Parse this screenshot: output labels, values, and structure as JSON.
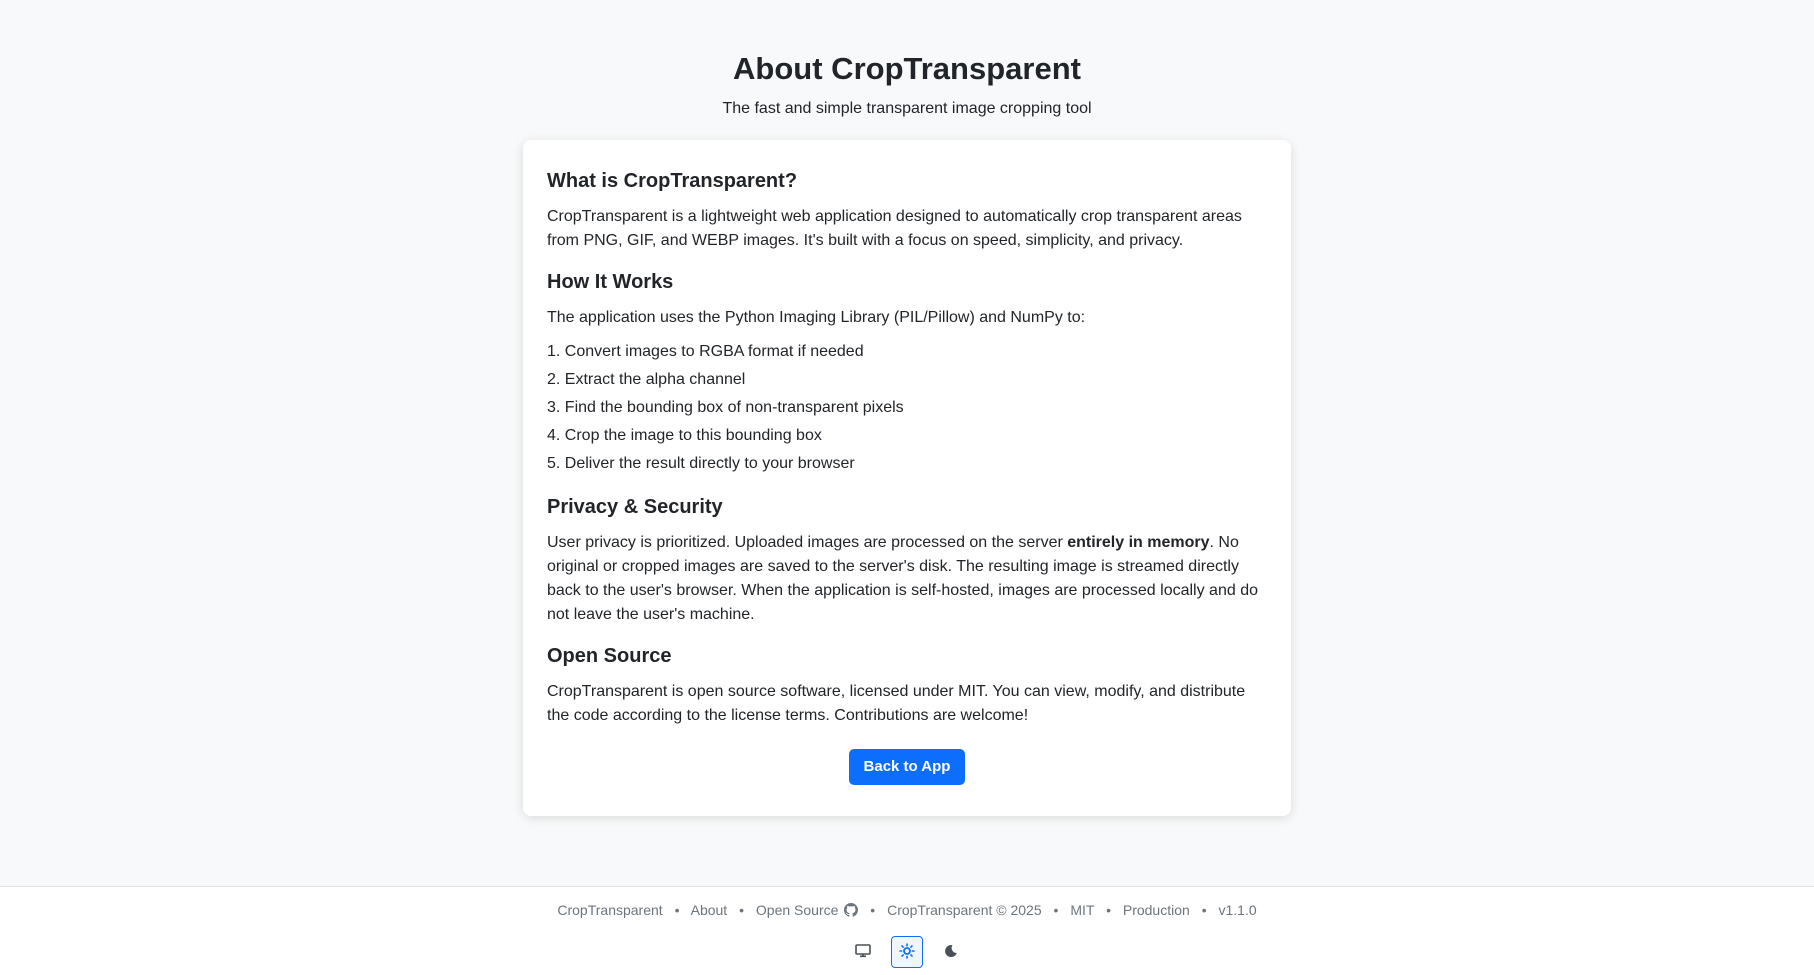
{
  "header": {
    "title": "About CropTransparent",
    "subtitle": "The fast and simple transparent image cropping tool"
  },
  "sections": {
    "what": {
      "heading": "What is CropTransparent?",
      "text": "CropTransparent is a lightweight web application designed to automatically crop transparent areas from PNG, GIF, and WEBP images. It's built with a focus on speed, simplicity, and privacy."
    },
    "how": {
      "heading": "How It Works",
      "intro": "The application uses the Python Imaging Library (PIL/Pillow) and NumPy to:",
      "steps": [
        "1. Convert images to RGBA format if needed",
        "2. Extract the alpha channel",
        "3. Find the bounding box of non-transparent pixels",
        "4. Crop the image to this bounding box",
        "5. Deliver the result directly to your browser"
      ]
    },
    "privacy": {
      "heading": "Privacy & Security",
      "text_before": "User privacy is prioritized. Uploaded images are processed on the server ",
      "text_bold": "entirely in memory",
      "text_after": ". No original or cropped images are saved to the server's disk. The resulting image is streamed directly back to the user's browser. When the application is self-hosted, images are processed locally and do not leave the user's machine."
    },
    "open_source": {
      "heading": "Open Source",
      "text": "CropTransparent is open source software, licensed under MIT. You can view, modify, and distribute the code according to the license terms. Contributions are welcome!"
    }
  },
  "back_button": "Back to App",
  "footer": {
    "links": {
      "app": "CropTransparent",
      "about": "About",
      "open_source": "Open Source",
      "copyright": "CropTransparent © 2025",
      "license": "MIT",
      "env": "Production",
      "version": "v1.1.0"
    },
    "separator": "•",
    "theme_icons": [
      "monitor-icon",
      "sun-icon",
      "moon-icon"
    ],
    "active_theme": "light"
  },
  "colors": {
    "accent": "#0d6efd",
    "page_bg": "#f8f9fa",
    "muted_text": "#6c757d"
  }
}
